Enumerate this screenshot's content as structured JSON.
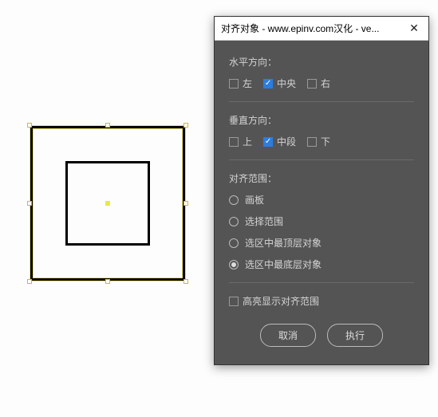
{
  "dialog": {
    "title": "对齐对象 - www.epinv.com汉化 - ve...",
    "horizontal": {
      "label": "水平方向：",
      "options": {
        "left": "左",
        "center": "中央",
        "right": "右"
      },
      "checked": "center"
    },
    "vertical": {
      "label": "垂直方向：",
      "options": {
        "top": "上",
        "middle": "中段",
        "bottom": "下"
      },
      "checked": "middle"
    },
    "scope": {
      "label": "对齐范围：",
      "options": {
        "artboard": "画板",
        "selection": "选择范围",
        "topmost": "选区中最顶层对象",
        "bottommost": "选区中最底层对象"
      },
      "selected": "bottommost"
    },
    "highlight_label": "高亮显示对齐范围",
    "buttons": {
      "cancel": "取消",
      "execute": "执行"
    }
  }
}
